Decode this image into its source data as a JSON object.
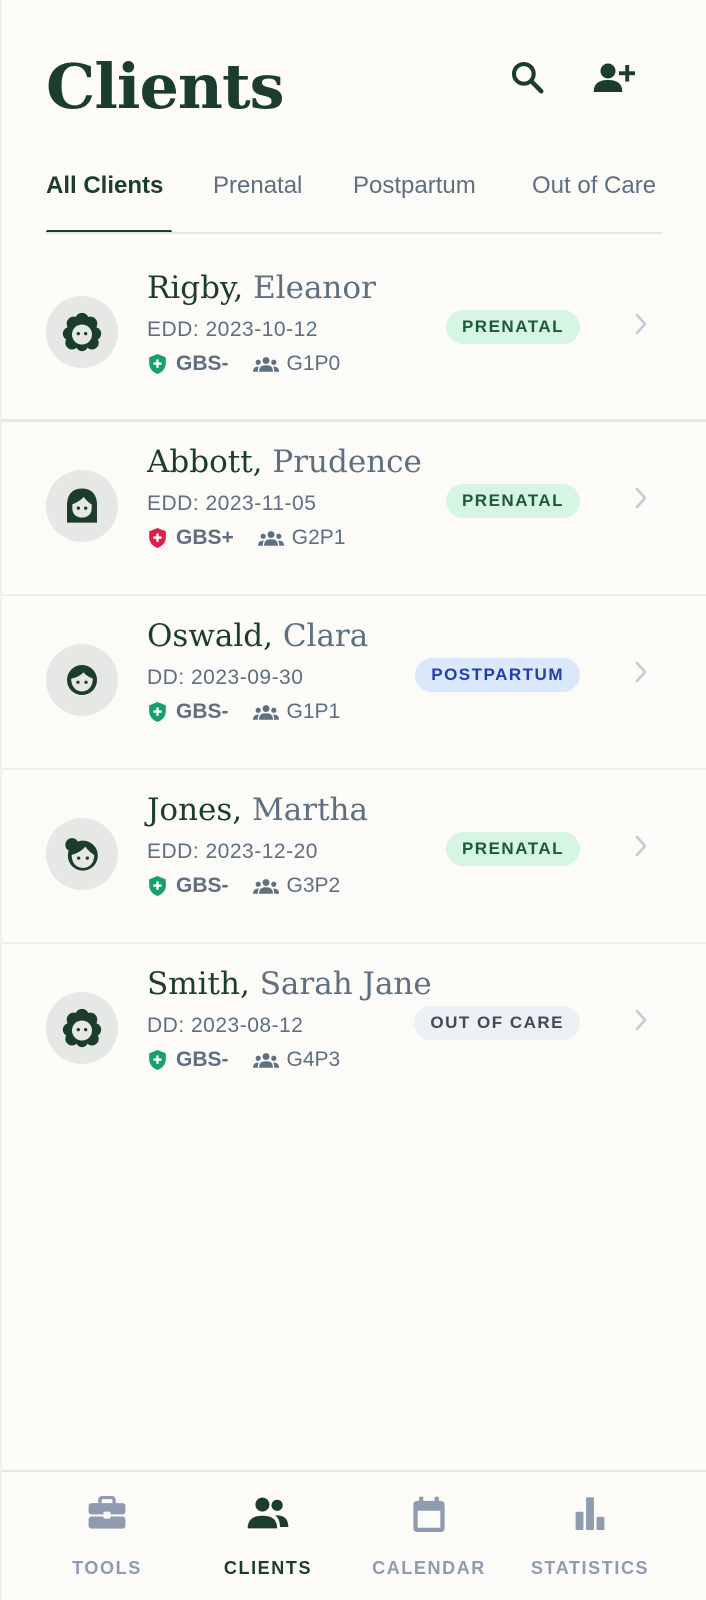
{
  "header": {
    "title": "Clients",
    "search_icon": "search-icon",
    "add_client_icon": "add-person-icon"
  },
  "tabs": [
    {
      "label": "All Clients",
      "active": true
    },
    {
      "label": "Prenatal",
      "active": false
    },
    {
      "label": "Postpartum",
      "active": false
    },
    {
      "label": "Out of Care",
      "active": false
    }
  ],
  "clients": [
    {
      "last": "Rigby,",
      "first": "Eleanor",
      "date": "EDD: 2023-10-12",
      "gbs": "GBS-",
      "gp": "G1P0",
      "status": "PRENATAL"
    },
    {
      "last": "Abbott,",
      "first": "Prudence",
      "date": "EDD: 2023-11-05",
      "gbs": "GBS+",
      "gp": "G2P1",
      "status": "PRENATAL"
    },
    {
      "last": "Oswald,",
      "first": "Clara",
      "date": "DD: 2023-09-30",
      "gbs": "GBS-",
      "gp": "G1P1",
      "status": "POSTPARTUM"
    },
    {
      "last": "Jones,",
      "first": "Martha",
      "date": "EDD: 2023-12-20",
      "gbs": "GBS-",
      "gp": "G3P2",
      "status": "PRENATAL"
    },
    {
      "last": "Smith,",
      "first": "Sarah Jane",
      "date": "DD: 2023-08-12",
      "gbs": "GBS-",
      "gp": "G4P3",
      "status": "OUT OF CARE"
    }
  ],
  "bottom_nav": [
    {
      "label": "TOOLS",
      "icon": "toolbox-icon",
      "active": false
    },
    {
      "label": "CLIENTS",
      "icon": "people-icon",
      "active": true
    },
    {
      "label": "CALENDAR",
      "icon": "calendar-icon",
      "active": false
    },
    {
      "label": "STATISTICS",
      "icon": "bar-chart-icon",
      "active": false
    }
  ],
  "colors": {
    "primary": "#1c3c2c",
    "background": "#fcfbf8",
    "gbs_negative": "#16a06a",
    "gbs_positive": "#e11d48",
    "prenatal_badge": "#d6f5e2",
    "postpartum_badge": "#dbe7fb",
    "out_of_care_badge": "#edf0f4"
  }
}
